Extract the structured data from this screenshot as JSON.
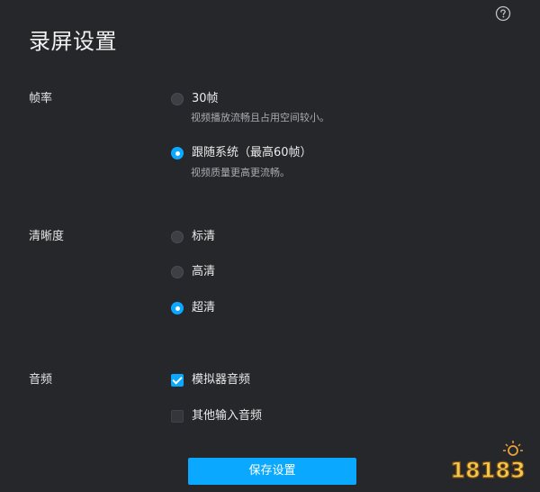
{
  "window": {
    "title": "录屏设置",
    "help_icon": "question-circle-icon"
  },
  "framerate": {
    "label": "帧率",
    "options": [
      {
        "label": "30帧",
        "description": "视频播放流畅且占用空间较小。",
        "selected": false
      },
      {
        "label": "跟随系统（最高60帧）",
        "description": "视频质量更高更流畅。",
        "selected": true
      }
    ]
  },
  "clarity": {
    "label": "清晰度",
    "options": [
      {
        "label": "标清",
        "selected": false
      },
      {
        "label": "高清",
        "selected": false
      },
      {
        "label": "超清",
        "selected": true
      }
    ]
  },
  "audio": {
    "label": "音频",
    "options": [
      {
        "label": "模拟器音频",
        "checked": true
      },
      {
        "label": "其他输入音频",
        "checked": false
      }
    ]
  },
  "footer": {
    "save_label": "保存设置"
  },
  "watermark": {
    "text": "18183"
  },
  "colors": {
    "background": "#26272b",
    "accent": "#0aa8ff",
    "text": "#e6e6e6",
    "muted": "#a9abb0"
  }
}
